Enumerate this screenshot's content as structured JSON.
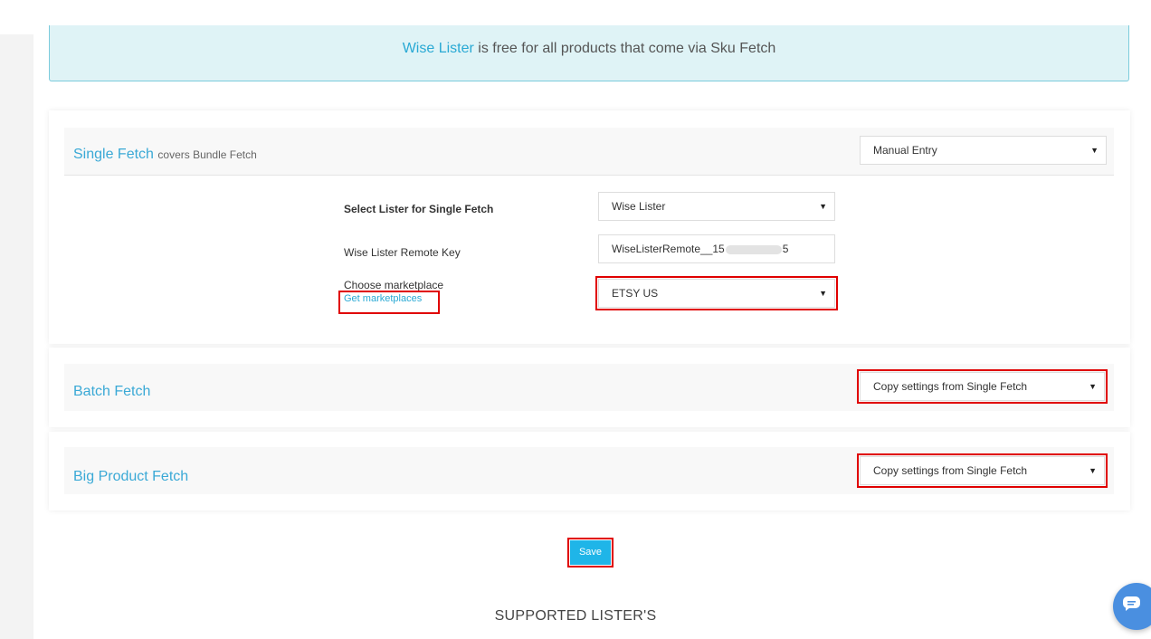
{
  "banner": {
    "brand": "Wise Lister",
    "text": " is free for all products that come via Sku Fetch"
  },
  "single_fetch": {
    "title": "Single Fetch",
    "subtitle": "covers Bundle Fetch",
    "mode_value": "Manual Entry",
    "lister_label": "Select Lister for Single Fetch",
    "lister_value": "Wise Lister",
    "remote_key_label": "Wise Lister Remote Key",
    "remote_key_value": "WiseListerRemote__15",
    "remote_key_tail": "5",
    "marketplace_label": "Choose marketplace",
    "get_marketplaces_link": "Get marketplaces",
    "marketplace_value": "ETSY US"
  },
  "batch_fetch": {
    "title": "Batch Fetch",
    "mode_value": "Copy settings from Single Fetch"
  },
  "big_product_fetch": {
    "title": "Big Product Fetch",
    "mode_value": "Copy settings from Single Fetch"
  },
  "save_label": "Save",
  "supported_heading": "SUPPORTED LISTER'S",
  "icons": {
    "caret": "caret-down-icon",
    "chat": "chat-icon"
  },
  "colors": {
    "accent": "#3aa9d6",
    "save_button": "#1fb5e8",
    "highlight": "#e00000",
    "banner_bg": "#dff3f6"
  }
}
